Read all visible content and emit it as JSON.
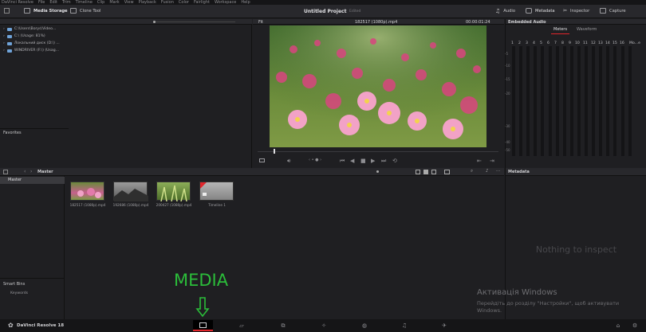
{
  "menu": [
    "DaVinci Resolve",
    "File",
    "Edit",
    "Trim",
    "Timeline",
    "Clip",
    "Mark",
    "View",
    "Playback",
    "Fusion",
    "Color",
    "Fairlight",
    "Workspace",
    "Help"
  ],
  "toolbar": {
    "media_storage": "Media Storage",
    "clone_tool": "Clone Tool",
    "project_title": "Untitled Project",
    "project_status": "Edited",
    "audio": "Audio",
    "metadata": "Metadata",
    "inspector": "Inspector",
    "capture": "Capture"
  },
  "media_storage": {
    "drives": [
      "C:\\Users\\Borys\\Video...",
      "C:\\ (Usage: 81%)",
      "Локальний диск (D:\\) ...",
      "WINDRIVER (F:\\) (Usag..."
    ],
    "favorites": "Favorites"
  },
  "viewer": {
    "fit": "Fit",
    "clip_name": "182517 (1080p).mp4",
    "timecode": "00:00:01:24"
  },
  "audio_panel": {
    "title": "Embedded Audio",
    "tabs": [
      "Meters",
      "Waveform"
    ],
    "channels": [
      "1",
      "2",
      "3",
      "4",
      "5",
      "6",
      "7",
      "8",
      "9",
      "10",
      "11",
      "12",
      "13",
      "14",
      "15",
      "16",
      "Mo...e"
    ],
    "scale": [
      "-5",
      "-10",
      "-15",
      "-20",
      "-30",
      "-40",
      "-50"
    ]
  },
  "media_pool": {
    "bin": "Master",
    "title": "Master",
    "smart_bins": "Smart Bins",
    "keywords": "Keywords",
    "clips": [
      {
        "label": "182517 (1080p).mp4"
      },
      {
        "label": "192686 (1080p).mp4"
      },
      {
        "label": "200427 (1080p).mp4"
      },
      {
        "label": "Timeline 1"
      }
    ]
  },
  "metadata_panel": {
    "title": "Metadata",
    "empty": "Nothing to inspect"
  },
  "overlay": {
    "media_label": "MEDIA",
    "activation_title": "Активація Windows",
    "activation_line1": "Перейдіть до розділу \"Настройки\", щоб активувати",
    "activation_line2": "Windows."
  },
  "footer": {
    "app_name": "DaVinci Resolve 18"
  },
  "colors": {
    "accent_red": "#e2252b",
    "annotation_green": "#2bbd3a"
  }
}
